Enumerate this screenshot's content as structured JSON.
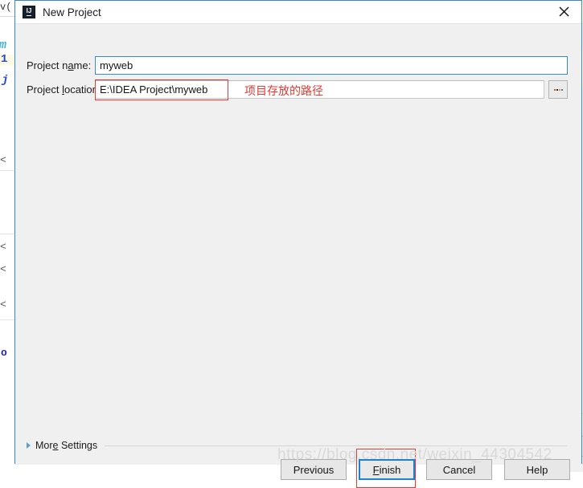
{
  "window": {
    "title": "New Project",
    "app_icon": "intellij-idea-icon",
    "close_icon": "close-icon"
  },
  "form": {
    "project_name": {
      "label_pre": "Project n",
      "label_mnemonic": "a",
      "label_post": "me:",
      "value": "myweb",
      "placeholder": ""
    },
    "project_location": {
      "label_pre": "Project ",
      "label_mnemonic": "l",
      "label_post": "ocation:",
      "value": "E:\\IDEA Project\\myweb",
      "placeholder": "",
      "browse_label": "...",
      "browse_icon": "ellipsis-icon"
    }
  },
  "annotations": {
    "path_note": "项目存放的路径",
    "color": "#e8382f"
  },
  "more_settings": {
    "label_pre": "Mor",
    "label_mnemonic": "e",
    "label_post": " Settings",
    "expander_icon": "chevron-right-icon"
  },
  "buttons": {
    "previous": "Previous",
    "finish_pre": "",
    "finish_mnemonic": "F",
    "finish_post": "inish",
    "cancel": "Cancel",
    "help": "Help"
  },
  "watermark": {
    "text": "https://blog.csdn.net/weixin_44304542"
  },
  "background_editor": {
    "glyphs": [
      "v(",
      "m",
      "1",
      "j",
      "<",
      "<",
      "<",
      "<",
      "o"
    ]
  },
  "colors": {
    "accent_focus": "#1f7fd0",
    "dialog_bg": "#f0f0f0",
    "annotation_red": "#e8382f",
    "field_focus_border": "#3a8ad0"
  }
}
